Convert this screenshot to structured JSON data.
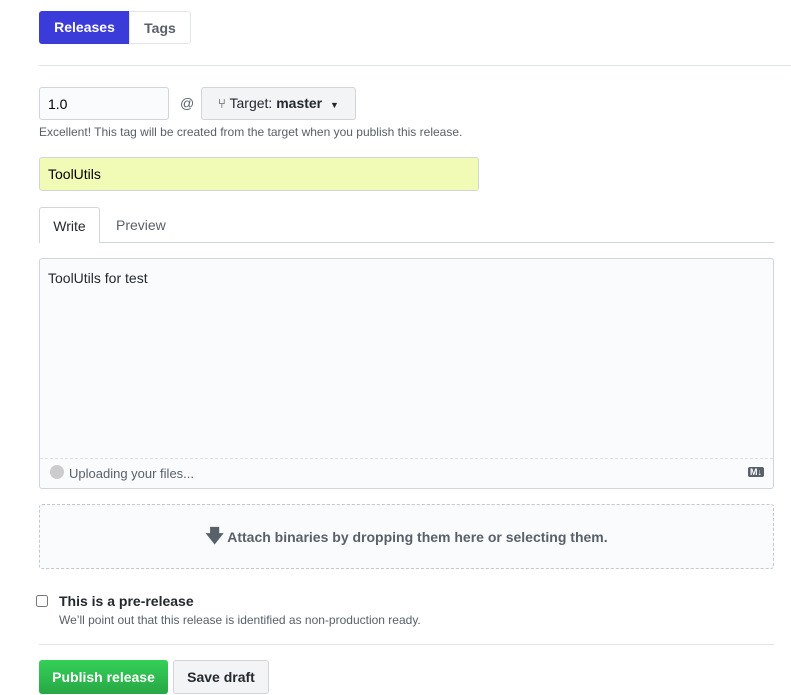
{
  "nav": {
    "releases": "Releases",
    "tags": "Tags"
  },
  "tag": {
    "value": "1.0",
    "at": "@",
    "target_label": "Target:",
    "target_branch": "master",
    "help": "Excellent! This tag will be created from the target when you publish this release."
  },
  "title": {
    "value": "ToolUtils"
  },
  "editor": {
    "tabs": [
      "Write",
      "Preview"
    ],
    "body": "ToolUtils for test",
    "upload_status": "Uploading your files...",
    "markdown_badge": "M↓"
  },
  "attach": {
    "text": "Attach binaries by dropping them here or selecting them."
  },
  "prerelease": {
    "label": "This is a pre-release",
    "note": "We’ll point out that this release is identified as non-production ready.",
    "checked": false
  },
  "actions": {
    "publish": "Publish release",
    "draft": "Save draft"
  },
  "colors": {
    "accent": "#3a3bd8",
    "publish": "#2cbe4e",
    "title_bg": "#f2fbb6"
  }
}
